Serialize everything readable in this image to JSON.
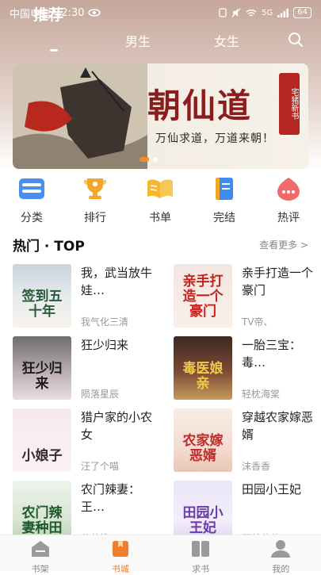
{
  "status_bar": {
    "carrier": "中国电信",
    "time": "12:30",
    "network": "5G",
    "battery": "64"
  },
  "tabs": [
    {
      "label": "推荐",
      "active": true
    },
    {
      "label": "男生"
    },
    {
      "label": "女生"
    }
  ],
  "banner": {
    "title": "朝仙道",
    "subtitle": "万仙求道，万道来朝！",
    "seal": "宅猪新书"
  },
  "categories": [
    {
      "label": "分类",
      "icon": "category-icon",
      "color": "#4a8ff0"
    },
    {
      "label": "排行",
      "icon": "trophy-icon",
      "color": "#f2a72a"
    },
    {
      "label": "书单",
      "icon": "open-book-icon",
      "color": "#f5b72c"
    },
    {
      "label": "完结",
      "icon": "finished-book-icon",
      "color": "#3d8cf0"
    },
    {
      "label": "热评",
      "icon": "comment-icon",
      "color": "#f06b6b"
    }
  ],
  "section": {
    "title": "热门 · TOP",
    "more": "查看更多 >"
  },
  "books": [
    {
      "title": "我，武当放牛娃…",
      "author": "我气化三清",
      "cover_text": "签到五十年"
    },
    {
      "title": "亲手打造一个豪门",
      "author": "TV帝、",
      "cover_text": "亲手打造一个豪门"
    },
    {
      "title": "狂少归来",
      "author": "陨落星辰",
      "cover_text": "狂少归来"
    },
    {
      "title": "一胎三宝：毒…",
      "author": "轻枕海棠",
      "cover_text": "毒医娘亲"
    },
    {
      "title": "猎户家的小农女",
      "author": "汪了个喵",
      "cover_text": "小娘子"
    },
    {
      "title": "穿越农家嫁恶婿",
      "author": "沫香香",
      "cover_text": "农家嫁恶婿"
    },
    {
      "title": "农门辣妻：王…",
      "author": "分花拂…",
      "cover_text": "农门辣妻种田"
    },
    {
      "title": "田园小王妃",
      "author": "西兰花花",
      "cover_text": "田园小王妃"
    }
  ],
  "bottom_nav": [
    {
      "label": "书架",
      "icon": "bookshelf-icon"
    },
    {
      "label": "书城",
      "icon": "bookstore-icon",
      "active": true
    },
    {
      "label": "求书",
      "icon": "request-book-icon"
    },
    {
      "label": "我的",
      "icon": "profile-icon"
    }
  ],
  "colors": {
    "accent": "#f07d2a",
    "banner_title": "#8a1e1e"
  }
}
